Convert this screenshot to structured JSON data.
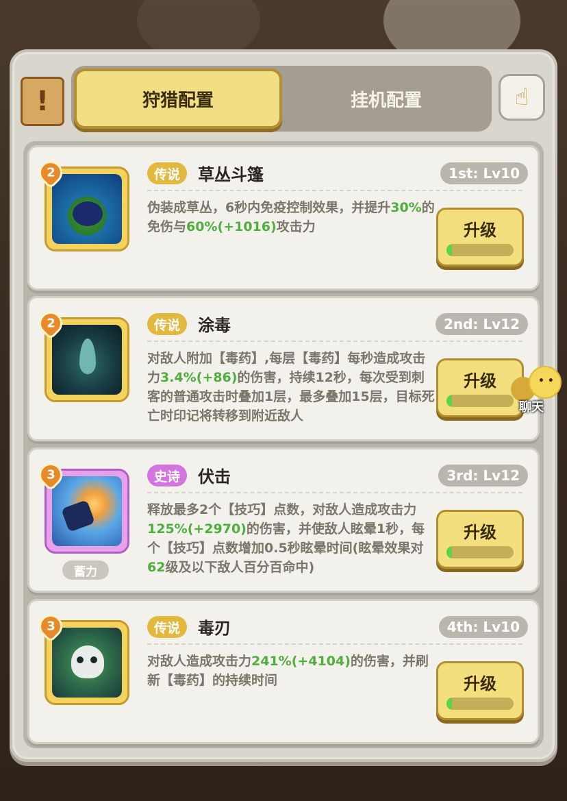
{
  "tabs": [
    {
      "label": "狩猎配置",
      "active": true
    },
    {
      "label": "挂机配置",
      "active": false
    }
  ],
  "icons": {
    "scroll": "scroll-icon",
    "help": "hand-map-icon",
    "chat": "chat-bubble-icon"
  },
  "chat_label": "聊天",
  "upgrade_label": "升级",
  "skills": [
    {
      "rarity": "传说",
      "rarity_type": "legend",
      "name": "草丛斗篷",
      "level": "1st: Lv10",
      "badge": "2",
      "desc": [
        {
          "t": "伪装成草丛，6秒内免疫控制效果，并提升",
          "g": false
        },
        {
          "t": "30%",
          "g": true
        },
        {
          "t": "的免伤与",
          "g": false
        },
        {
          "t": "60%(+1016)",
          "g": true
        },
        {
          "t": "攻击力",
          "g": false
        }
      ],
      "progress": 0.06,
      "tag": ""
    },
    {
      "rarity": "传说",
      "rarity_type": "legend",
      "name": "涂毒",
      "level": "2nd: Lv12",
      "badge": "2",
      "desc": [
        {
          "t": "对敌人附加【毒药】,每层【毒药】每秒造成攻击力",
          "g": false
        },
        {
          "t": "3.4%(+86)",
          "g": true
        },
        {
          "t": "的伤害，持续12秒，每次受到刺客的普通攻击时叠加1层，最多叠加15层，目标死亡时印记将转移到附近敌人",
          "g": false
        }
      ],
      "progress": 0.03,
      "tag": ""
    },
    {
      "rarity": "史诗",
      "rarity_type": "epic",
      "name": "伏击",
      "level": "3rd: Lv12",
      "badge": "3",
      "desc": [
        {
          "t": "释放最多2个【技巧】点数，对敌人造成攻击力",
          "g": false
        },
        {
          "t": "125%(+2970)",
          "g": true
        },
        {
          "t": "的伤害，并使敌人眩晕1秒，每个【技巧】点数增加0.5秒眩晕时间(眩晕效果对",
          "g": false
        },
        {
          "t": "62",
          "g": true
        },
        {
          "t": "级及以下敌人百分百命中)",
          "g": false
        }
      ],
      "progress": 0.03,
      "tag": "蓄力"
    },
    {
      "rarity": "传说",
      "rarity_type": "legend",
      "name": "毒刃",
      "level": "4th: Lv10",
      "badge": "3",
      "desc": [
        {
          "t": "对敌人造成攻击力",
          "g": false
        },
        {
          "t": "241%(+4104)",
          "g": true
        },
        {
          "t": "的伤害，并刷新【毒药】的持续时间",
          "g": false
        }
      ],
      "progress": 0.03,
      "tag": ""
    }
  ]
}
